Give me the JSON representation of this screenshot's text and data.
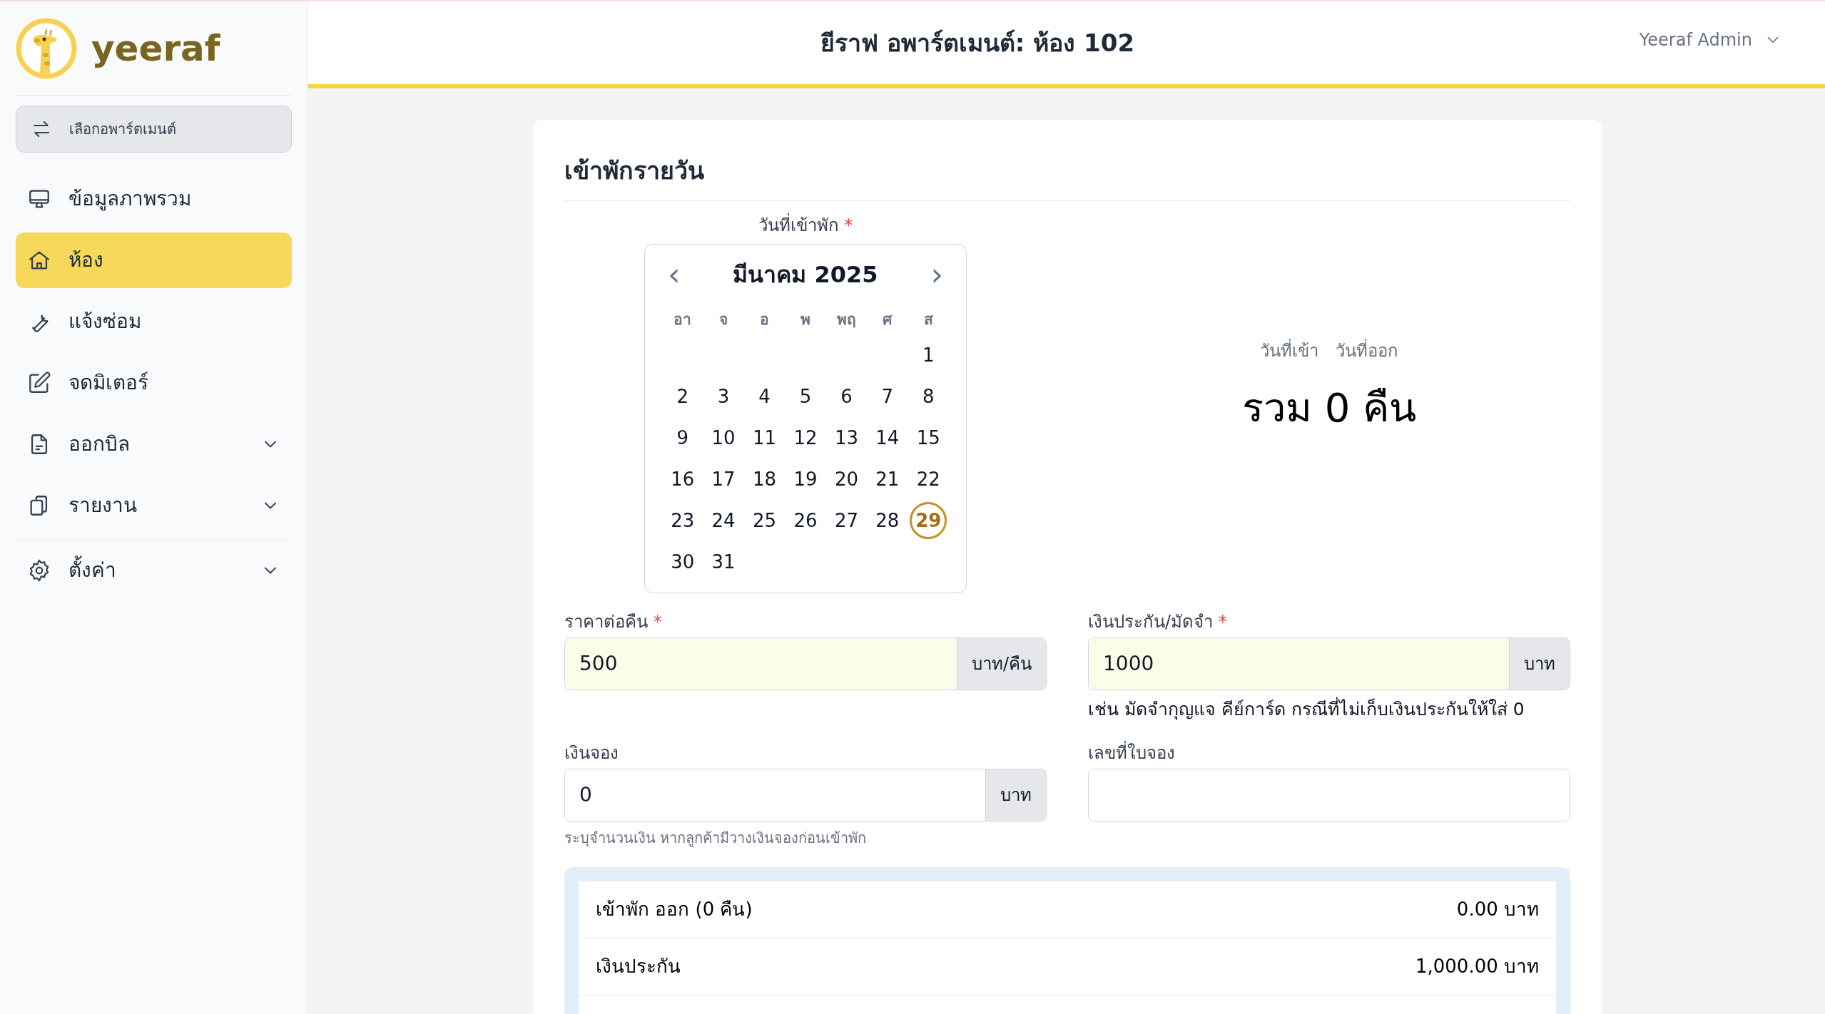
{
  "sidebar": {
    "logo_text": "yeeraf",
    "switch_button": "เลือกอพาร์ตเมนต์",
    "items": [
      {
        "label": "ข้อมูลภาพรวม",
        "selected": false,
        "divider_before": false
      },
      {
        "label": "ห้อง",
        "selected": true,
        "divider_before": false
      },
      {
        "label": "แจ้งซ่อม",
        "selected": false,
        "divider_before": false
      },
      {
        "label": "จดมิเตอร์",
        "selected": false,
        "divider_before": false
      },
      {
        "label": "ออกบิล",
        "selected": false,
        "expanded": false,
        "divider_before": false
      },
      {
        "label": "รายงาน",
        "selected": false,
        "expanded": false,
        "divider_before": false
      },
      {
        "label": "ตั้งค่า",
        "selected": false,
        "expanded": false,
        "divider_before": true
      }
    ]
  },
  "header": {
    "title": "ยีราฟ อพาร์ตเมนต์: ห้อง 102",
    "user": "Yeeraf Admin"
  },
  "card": {
    "title": "เข้าพักรายวัน",
    "date_picker": {
      "label": "วันที่เข้าพัก",
      "required_mark": "*",
      "prev": "‹",
      "month": "มีนาคม 2025",
      "next": "›",
      "weekdays": [
        "อา",
        "จ",
        "อ",
        "พ",
        "พฤ",
        "ศ",
        "ส"
      ],
      "weeks": [
        [
          {
            "label": "1",
            "selected": false
          }
        ],
        [
          {
            "label": "2",
            "selected": false
          },
          {
            "label": "3",
            "selected": false
          },
          {
            "label": "4",
            "selected": false
          },
          {
            "label": "5",
            "selected": false
          },
          {
            "label": "6",
            "selected": false
          },
          {
            "label": "7",
            "selected": false
          },
          {
            "label": "8",
            "selected": false
          }
        ],
        [
          {
            "label": "9",
            "selected": false
          },
          {
            "label": "10",
            "selected": false
          },
          {
            "label": "11",
            "selected": false
          },
          {
            "label": "12",
            "selected": false
          },
          {
            "label": "13",
            "selected": false
          },
          {
            "label": "14",
            "selected": false
          },
          {
            "label": "15",
            "selected": false
          }
        ],
        [
          {
            "label": "16",
            "selected": false
          },
          {
            "label": "17",
            "selected": false
          },
          {
            "label": "18",
            "selected": false
          },
          {
            "label": "19",
            "selected": false
          },
          {
            "label": "20",
            "selected": false
          },
          {
            "label": "21",
            "selected": false
          },
          {
            "label": "22",
            "selected": false
          }
        ],
        [
          {
            "label": "23",
            "selected": false
          },
          {
            "label": "24",
            "selected": false
          },
          {
            "label": "25",
            "selected": false
          },
          {
            "label": "26",
            "selected": false
          },
          {
            "label": "27",
            "selected": false
          },
          {
            "label": "28",
            "selected": false
          },
          {
            "label": "29",
            "selected": true
          }
        ],
        [
          {
            "label": "30",
            "selected": false
          },
          {
            "label": "31",
            "selected": false
          }
        ]
      ]
    },
    "stay_summary": {
      "check_in_label": "วันที่เข้า",
      "check_out_label": "วันที่ออก",
      "total": "รวม 0 คืน"
    },
    "fields": [
      {
        "label": "ราคาต่อคืน",
        "required_mark": "*",
        "value": "500",
        "unit": "บาท/คืน",
        "highlighted": true
      },
      {
        "label": "เงินประกัน/มัดจำ",
        "required_mark": "*",
        "value": "1000",
        "unit": "บาท",
        "highlighted": true,
        "hint": "เช่น มัดจำกุญแจ คีย์การ์ด กรณีที่ไม่เก็บเงินประกันให้ใส่ 0"
      },
      {
        "label": "เงินจอง",
        "value": "0",
        "unit": "บาท",
        "highlighted": false,
        "hint": "ระบุจำนวนเงิน หากลูกค้ามีวางเงินจองก่อนเข้าพัก"
      },
      {
        "label": "เลขที่ใบจอง",
        "highlighted": false
      }
    ],
    "totals": [
      {
        "label": "เข้าพัก ออก (0 คืน)",
        "amount": "0.00 บาท"
      },
      {
        "label": "เงินประกัน",
        "amount": "1,000.00 บาท"
      }
    ]
  }
}
